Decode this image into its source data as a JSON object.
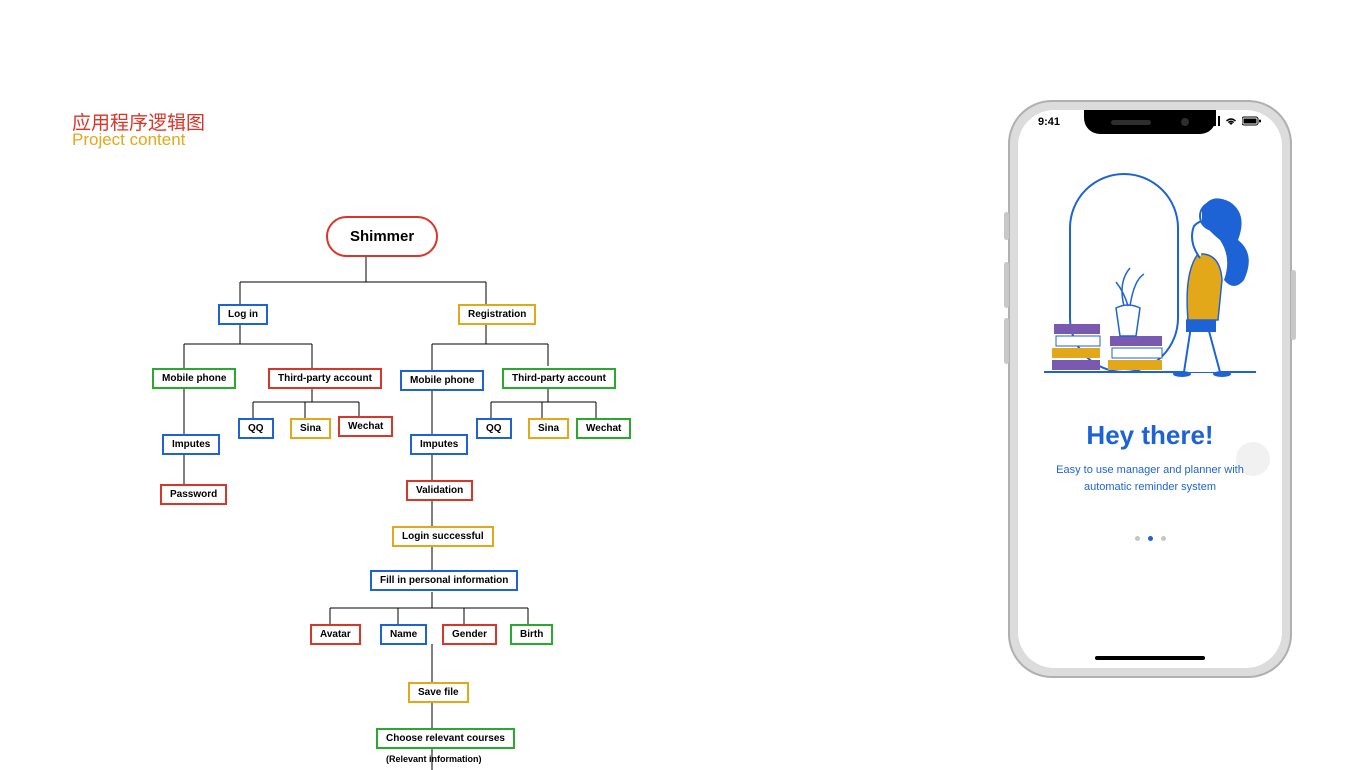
{
  "title": {
    "cn": "应用程序逻辑图",
    "en": "Project content"
  },
  "diagram": {
    "root": "Shimmer",
    "login": "Log in",
    "registration": "Registration",
    "mobile1": "Mobile phone",
    "third1": "Third-party account",
    "mobile2": "Mobile phone",
    "third2": "Third-party account",
    "qq1": "QQ",
    "sina1": "Sina",
    "wechat1": "Wechat",
    "qq2": "QQ",
    "sina2": "Sina",
    "wechat2": "Wechat",
    "imputes1": "Imputes",
    "password": "Password",
    "imputes2": "Imputes",
    "validation": "Validation",
    "login_success": "Login successful",
    "fill_info": "Fill in personal information",
    "avatar": "Avatar",
    "name": "Name",
    "gender": "Gender",
    "birth": "Birth",
    "save_file": "Save file",
    "choose_courses": "Choose relevant courses",
    "footnote": "(Relevant information)"
  },
  "phone": {
    "time": "9:41",
    "hero_title": "Hey there!",
    "hero_sub": "Easy to use manager and planner with automatic reminder system",
    "page_index": 1,
    "page_count": 3
  },
  "colors": {
    "red": "#d9362a",
    "yellow": "#e3a81a",
    "blue": "#1e63d6",
    "green": "#2aa92f",
    "purple": "#7a5ab0"
  }
}
